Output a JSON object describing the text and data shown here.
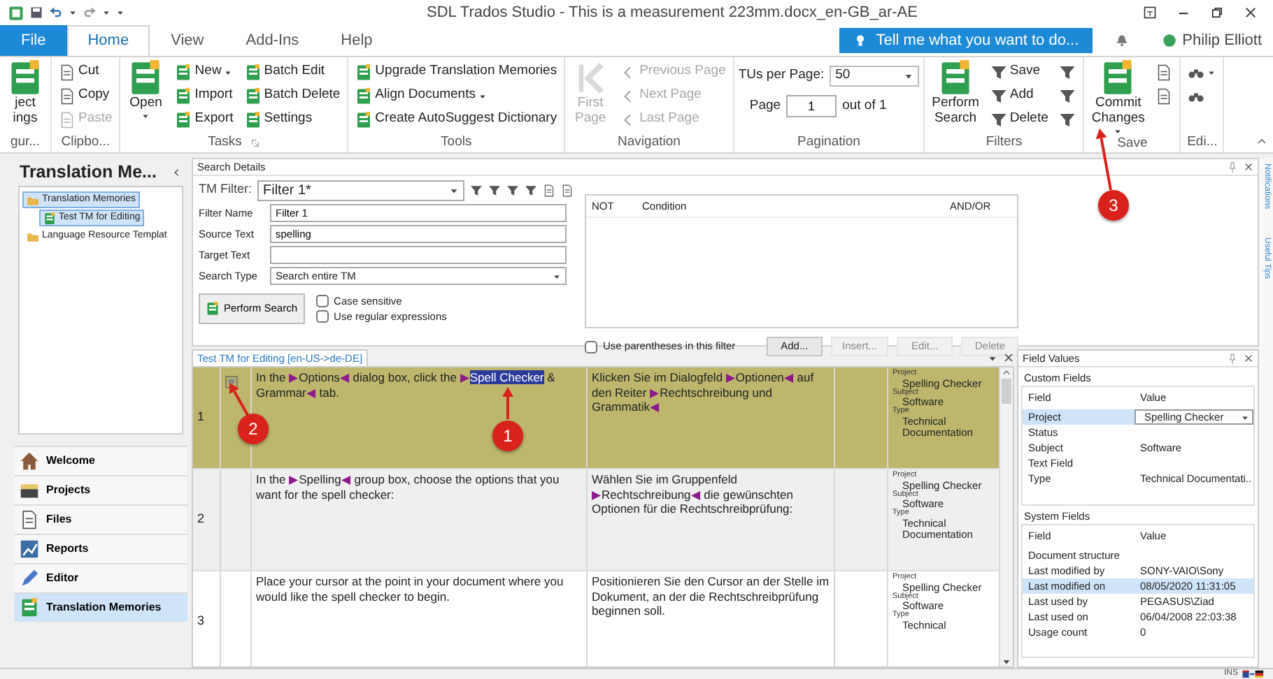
{
  "title_bar": {
    "title": "SDL Trados Studio - This is a measurement 223mm.docx_en-GB_ar-AE"
  },
  "ribbon_tabs": [
    {
      "label": "File",
      "kind": "file",
      "selected": false
    },
    {
      "label": "Home",
      "kind": "tab",
      "selected": true
    },
    {
      "label": "View",
      "kind": "tab",
      "selected": false
    },
    {
      "label": "Add-Ins",
      "kind": "tab",
      "selected": false
    },
    {
      "label": "Help",
      "kind": "tab",
      "selected": false
    }
  ],
  "tell_me": {
    "label": "Tell me what you want to do..."
  },
  "user": {
    "name": "Philip Elliott"
  },
  "ribbon_groups": [
    {
      "label": "gur...",
      "columns": [
        [
          {
            "kind": "large",
            "lines": [
              "ject",
              "ings"
            ],
            "disabled": false,
            "dropdown": false
          }
        ]
      ]
    },
    {
      "label": "Clipbo...",
      "columns": [
        [
          {
            "kind": "small",
            "label": "Cut",
            "disabled": false,
            "dropdown": false
          },
          {
            "kind": "small",
            "label": "Copy",
            "disabled": false,
            "dropdown": false
          },
          {
            "kind": "small",
            "label": "Paste",
            "disabled": true,
            "dropdown": false
          }
        ]
      ]
    },
    {
      "label": "Tasks",
      "launcher": true,
      "columns": [
        [
          {
            "kind": "large",
            "lines": [
              "Open"
            ],
            "disabled": false,
            "dropdown": true
          }
        ],
        [
          {
            "kind": "small",
            "label": "New",
            "disabled": false,
            "dropdown": true
          },
          {
            "kind": "small",
            "label": "Import",
            "disabled": false,
            "dropdown": false
          },
          {
            "kind": "small",
            "label": "Export",
            "disabled": false,
            "dropdown": false
          }
        ],
        [
          {
            "kind": "small",
            "label": "Batch Edit",
            "disabled": false,
            "dropdown": false
          },
          {
            "kind": "small",
            "label": "Batch Delete",
            "disabled": false,
            "dropdown": false
          },
          {
            "kind": "small",
            "label": "Settings",
            "disabled": false,
            "dropdown": false
          }
        ]
      ]
    },
    {
      "label": "Tools",
      "columns": [
        [
          {
            "kind": "small",
            "label": "Upgrade Translation Memories",
            "disabled": false,
            "dropdown": false
          },
          {
            "kind": "small",
            "label": "Align Documents",
            "disabled": false,
            "dropdown": true
          },
          {
            "kind": "small",
            "label": "Create AutoSuggest Dictionary",
            "disabled": false,
            "dropdown": false
          }
        ]
      ]
    },
    {
      "label": "Navigation",
      "columns": [
        [
          {
            "kind": "large",
            "lines": [
              "First",
              "Page"
            ],
            "disabled": true,
            "dropdown": false
          }
        ],
        [
          {
            "kind": "small",
            "label": "Previous Page",
            "disabled": true,
            "dropdown": false
          },
          {
            "kind": "small",
            "label": "Next Page",
            "disabled": true,
            "dropdown": false
          },
          {
            "kind": "small",
            "label": "Last Page",
            "disabled": true,
            "dropdown": false
          }
        ]
      ]
    },
    {
      "label": "Pagination",
      "columns": [
        [
          {
            "kind": "combo",
            "label": "TUs per Page:",
            "value": "50"
          },
          {
            "kind": "spin",
            "label": "Page",
            "value": "1",
            "suffix": "out of 1"
          }
        ]
      ]
    },
    {
      "label": "Filters",
      "columns": [
        [
          {
            "kind": "large",
            "lines": [
              "Perform",
              "Search"
            ],
            "disabled": false,
            "dropdown": false
          }
        ],
        [
          {
            "kind": "small",
            "label": "Save",
            "disabled": false,
            "dropdown": false
          },
          {
            "kind": "small",
            "label": "Add",
            "disabled": false,
            "dropdown": false
          },
          {
            "kind": "small",
            "label": "Delete",
            "disabled": false,
            "dropdown": false
          }
        ],
        [
          {
            "kind": "icon",
            "disabled": false,
            "dropdown": false
          },
          {
            "kind": "icon",
            "disabled": false,
            "dropdown": false
          },
          {
            "kind": "icon",
            "disabled": false,
            "dropdown": false
          }
        ]
      ]
    },
    {
      "label": "Save",
      "columns": [
        [
          {
            "kind": "large",
            "lines": [
              "Commit",
              "Changes"
            ],
            "disabled": false,
            "dropdown": true
          }
        ],
        [
          {
            "kind": "icon",
            "disabled": false,
            "dropdown": false
          },
          {
            "kind": "icon",
            "disabled": false,
            "dropdown": false
          }
        ]
      ]
    },
    {
      "label": "Edi...",
      "columns": [
        [
          {
            "kind": "icon",
            "disabled": false,
            "dropdown": true
          },
          {
            "kind": "icon",
            "disabled": false,
            "dropdown": false
          }
        ]
      ]
    }
  ],
  "navigator": {
    "title": "Translation Me...",
    "tree": [
      {
        "label": "Translation Memories",
        "kind": "folder",
        "selected": true,
        "children": [
          {
            "label": "Test TM for Editing",
            "kind": "tm",
            "selected": true
          }
        ]
      },
      {
        "label": "Language Resource Templat",
        "kind": "folder",
        "selected": false
      }
    ]
  },
  "nav_buttons": [
    {
      "label": "Welcome",
      "selected": false
    },
    {
      "label": "Projects",
      "selected": false
    },
    {
      "label": "Files",
      "selected": false
    },
    {
      "label": "Reports",
      "selected": false
    },
    {
      "label": "Editor",
      "selected": false
    },
    {
      "label": "Translation Memories",
      "selected": true
    }
  ],
  "search_details": {
    "title": "Search Details",
    "tm_filter": {
      "label": "TM Filter:",
      "value": "Filter 1*"
    },
    "fields": [
      {
        "label": "Filter Name",
        "kind": "text",
        "value": "Filter 1"
      },
      {
        "label": "Source Text",
        "kind": "text",
        "value": "spelling"
      },
      {
        "label": "Target Text",
        "kind": "text"
      },
      {
        "label": "Search Type",
        "kind": "select",
        "value": "Search entire TM"
      }
    ],
    "perform_search": {
      "label": "Perform Search"
    },
    "options": [
      {
        "label": "Case sensitive",
        "checked": false
      },
      {
        "label": "Use regular expressions",
        "checked": false
      }
    ],
    "conditions": {
      "columns": [
        "NOT",
        "Condition",
        "AND/OR"
      ]
    },
    "parentheses": {
      "label": "Use parentheses in this filter",
      "checked": false
    },
    "buttons": [
      {
        "label": "Add...",
        "disabled": false
      },
      {
        "label": "Insert...",
        "disabled": true
      },
      {
        "label": "Edit...",
        "disabled": true
      },
      {
        "label": "Delete",
        "disabled": true
      }
    ]
  },
  "results": {
    "tab": "Test TM for Editing [en-US->de-DE]",
    "rows": [
      {
        "number": "1",
        "selected": true,
        "edited": true,
        "source": [
          {
            "kind": "text",
            "text": "In the "
          },
          {
            "kind": "tag",
            "text": "▶"
          },
          {
            "kind": "text",
            "text": "Options"
          },
          {
            "kind": "tag",
            "text": "◀"
          },
          {
            "kind": "text",
            "text": " dialog box, click the "
          },
          {
            "kind": "tag",
            "text": "▶"
          },
          {
            "kind": "highlight",
            "text": "Spell Checker"
          },
          {
            "kind": "text",
            "text": " & Grammar"
          },
          {
            "kind": "tag",
            "text": "◀"
          },
          {
            "kind": "text",
            "text": " tab."
          }
        ],
        "target": [
          {
            "kind": "text",
            "text": "Klicken Sie im Dialogfeld "
          },
          {
            "kind": "tag",
            "text": "▶"
          },
          {
            "kind": "text",
            "text": "Optionen"
          },
          {
            "kind": "tag",
            "text": "◀"
          },
          {
            "kind": "text",
            "text": " auf den Reiter "
          },
          {
            "kind": "tag",
            "text": "▶"
          },
          {
            "kind": "text",
            "text": "Rechtschreibung und Grammatik"
          },
          {
            "kind": "tag",
            "text": "◀"
          }
        ],
        "fields": [
          {
            "name": "Project",
            "value": "Spelling Checker"
          },
          {
            "name": "Subject",
            "value": "Software"
          },
          {
            "name": "Type",
            "value": "Technical Documentation"
          }
        ]
      },
      {
        "number": "2",
        "selected": false,
        "edited": false,
        "source": [
          {
            "kind": "text",
            "text": "In the "
          },
          {
            "kind": "tag",
            "text": "▶"
          },
          {
            "kind": "text",
            "text": "Spelling"
          },
          {
            "kind": "tag",
            "text": "◀"
          },
          {
            "kind": "text",
            "text": " group box, choose the options that you want for the spell checker:"
          }
        ],
        "target": [
          {
            "kind": "text",
            "text": "Wählen Sie im Gruppenfeld "
          },
          {
            "kind": "tag",
            "text": "▶"
          },
          {
            "kind": "text",
            "text": "Rechtschreibung"
          },
          {
            "kind": "tag",
            "text": "◀"
          },
          {
            "kind": "text",
            "text": " die gewünschten Optionen für die Rechtschreibprüfung:"
          }
        ],
        "fields": [
          {
            "name": "Project",
            "value": "Spelling Checker"
          },
          {
            "name": "Subject",
            "value": "Software"
          },
          {
            "name": "Type",
            "value": "Technical Documentation"
          }
        ]
      },
      {
        "number": "3",
        "selected": false,
        "edited": false,
        "source": [
          {
            "kind": "text",
            "text": "Place your cursor at the point in your document where you would like the spell checker to begin."
          }
        ],
        "target": [
          {
            "kind": "text",
            "text": "Positionieren Sie den Cursor an der Stelle im Dokument, an der die Rechtschreibprüfung beginnen soll."
          }
        ],
        "fields": [
          {
            "name": "Project",
            "value": "Spelling Checker"
          },
          {
            "name": "Subject",
            "value": "Software"
          },
          {
            "name": "Type",
            "value": "Technical"
          }
        ]
      }
    ]
  },
  "field_values": {
    "title": "Field Values",
    "custom": {
      "title": "Custom Fields",
      "columns": [
        "Field",
        "Value"
      ],
      "rows": [
        {
          "field": "Project",
          "value": "Spelling Checker",
          "kind": "dropdown",
          "selected": true
        },
        {
          "field": "Status",
          "kind": "plain",
          "selected": false
        },
        {
          "field": "Subject",
          "value": "Software",
          "kind": "plain",
          "selected": false
        },
        {
          "field": "Text Field",
          "kind": "plain",
          "selected": false
        },
        {
          "field": "Type",
          "value": "Technical Documentati..",
          "kind": "plain",
          "selected": false
        }
      ]
    },
    "system": {
      "title": "System Fields",
      "columns": [
        "Field",
        "Value"
      ],
      "rows": [
        {
          "field": "Document structure",
          "selected": false
        },
        {
          "field": "Last modified by",
          "value": "SONY-VAIO\\Sony",
          "selected": false
        },
        {
          "field": "Last modified on",
          "value": "08/05/2020 11:31:05",
          "selected": true
        },
        {
          "field": "Last used by",
          "value": "PEGASUS\\Ziad",
          "selected": false
        },
        {
          "field": "Last used on",
          "value": "06/04/2008 22:03:38",
          "selected": false
        },
        {
          "field": "Usage count",
          "value": "0",
          "selected": false
        }
      ]
    }
  },
  "side_tabs": [
    {
      "label": "Notifications"
    },
    {
      "label": "Useful Tips"
    }
  ],
  "status_bar": {
    "mode": "INS"
  },
  "annotations": [
    {
      "label": "1"
    },
    {
      "label": "2"
    },
    {
      "label": "3"
    }
  ]
}
